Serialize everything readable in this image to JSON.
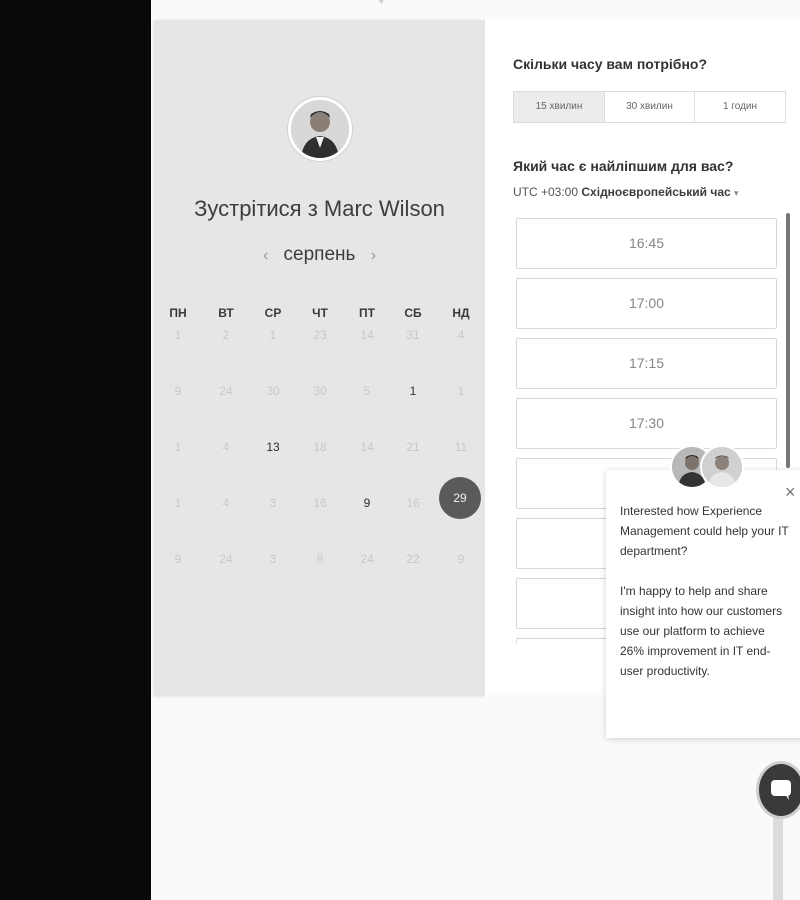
{
  "calendar": {
    "title": "Зустрітися з Marc Wilson",
    "month": "серпень",
    "prev_arrow": "‹",
    "next_arrow": "›",
    "weekdays": [
      "ПН",
      "ВТ",
      "СР",
      "ЧТ",
      "ПТ",
      "СБ",
      "НД"
    ],
    "weeks": [
      [
        "1",
        "2",
        "1",
        "23",
        "14",
        "31",
        "4"
      ],
      [
        "9",
        "24",
        "30",
        "30",
        "5",
        "1",
        "1"
      ],
      [
        "1",
        "4",
        "13",
        "18",
        "14",
        "21",
        "11"
      ],
      [
        "1",
        "4",
        "3",
        "16",
        "9",
        "16",
        "29"
      ],
      [
        "9",
        "24",
        "3",
        "8",
        "24",
        "22",
        "9"
      ]
    ],
    "selected_day": "29"
  },
  "duration": {
    "question": "Скільки часу вам потрібно?",
    "options": [
      "15 хвилин",
      "30 хвилин",
      "1 годин"
    ],
    "selected": "15 хвилин"
  },
  "time": {
    "question": "Який час є найліпшим для вас?",
    "tz_offset": "UTC +03:00",
    "tz_name": "Східноєвропейський час",
    "tz_caret": "▾",
    "slots": [
      "16:45",
      "17:00",
      "17:15",
      "17:30",
      "",
      "",
      ""
    ]
  },
  "chat": {
    "close": "×",
    "message_1": "Interested how Experience Management could help your IT department?",
    "message_2": "I'm happy to help and share insight into how our customers use our platform to achieve 26% improvement in IT end-user productivity."
  },
  "icons": {
    "host_avatar": "avatar",
    "chat_launcher": "chat-bubble-icon"
  }
}
